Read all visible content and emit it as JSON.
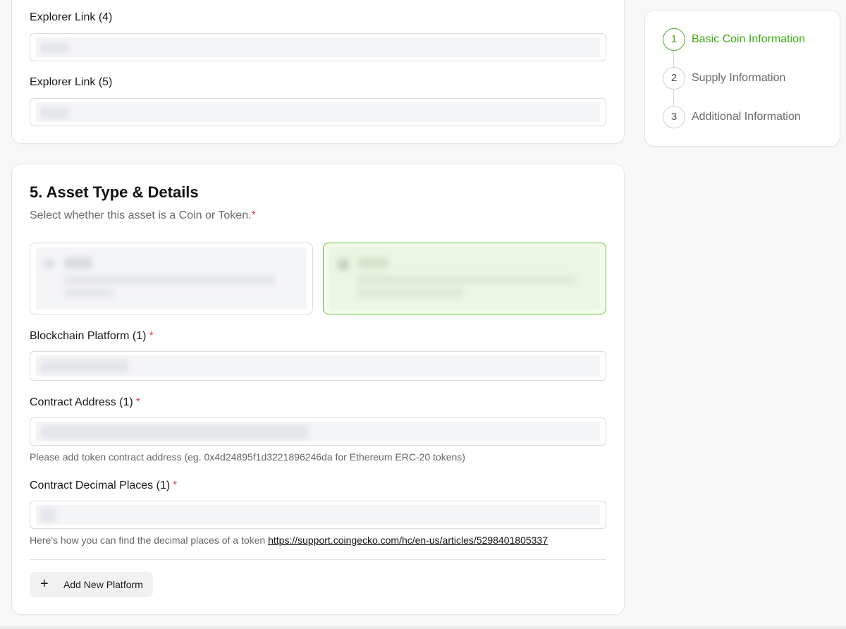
{
  "explorer": {
    "link4_label": "Explorer Link (4)",
    "link5_label": "Explorer Link (5)"
  },
  "asset_section": {
    "title": "5. Asset Type & Details",
    "subtitle": "Select whether this asset is a Coin or Token.",
    "required_mark": "*",
    "options_note": "option card contents are blurred in the screenshot"
  },
  "platform": {
    "blockchain_label": "Blockchain Platform (1)",
    "contract_label": "Contract Address (1)",
    "contract_help": "Please add token contract address (eg. 0x4d24895f1d3221896246da for Ethereum ERC-20 tokens)",
    "decimals_label": "Contract Decimal Places (1)",
    "decimals_help_prefix": "Here's how you can find the decimal places of a token",
    "decimals_help_link": "https://support.coingecko.com/hc/en-us/articles/5298401805337",
    "add_button_icon": "+",
    "add_button_label": "Add New Platform"
  },
  "steps": [
    {
      "number": "1",
      "label": "Basic Coin Information",
      "active": true
    },
    {
      "number": "2",
      "label": "Supply Information",
      "active": false
    },
    {
      "number": "3",
      "label": "Additional Information",
      "active": false
    }
  ],
  "colors": {
    "accent_green": "#4caf1c",
    "required_red": "#e5484d",
    "selected_border": "#6bc43a"
  }
}
